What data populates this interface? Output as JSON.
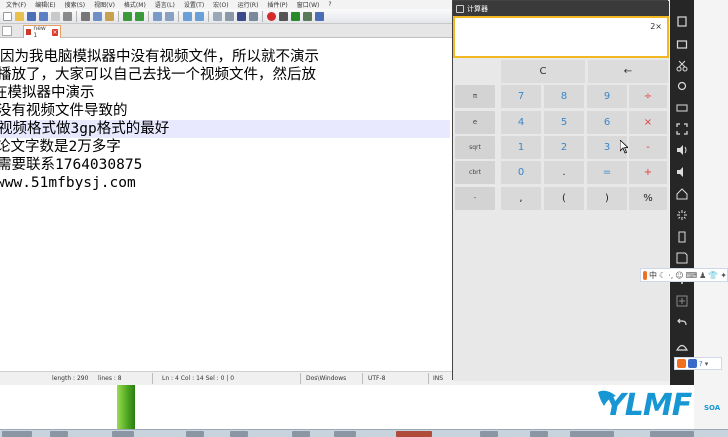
{
  "editor": {
    "menu": [
      "文件(F)",
      "编辑(E)",
      "搜索(S)",
      "视图(V)",
      "格式(M)",
      "语言(L)",
      "设置(T)",
      "宏(O)",
      "运行(R)",
      "插件(P)",
      "窗口(W)",
      "?"
    ],
    "tab": {
      "label": "new 1"
    },
    "lines": [
      "因为我电脑模拟器中没有视频文件，所以就不演示",
      "播放了，大家可以自己去找一个视频文件，然后放",
      "在模拟器中演示",
      "没有视频文件导致的",
      "视频格式做3gp格式的最好",
      "论文字数是2万多字",
      "需要联系1764030875",
      "www.51mfbysj.com"
    ],
    "status": {
      "length": "length : 290",
      "lines": "lines : 8",
      "position": "Ln : 4    Col : 14    Sel : 0 | 0",
      "eol": "Dos\\Windows",
      "encoding": "UTF-8",
      "mode": "INS"
    }
  },
  "emulator": {
    "app_title": "计算器",
    "display": {
      "formula": "2×"
    },
    "keys": {
      "clear": "C",
      "backspace": "←",
      "rows": [
        [
          "π",
          "7",
          "8",
          "9",
          "÷"
        ],
        [
          "e",
          "4",
          "5",
          "6",
          "×"
        ],
        [
          "sqrt",
          "1",
          "2",
          "3",
          "-"
        ],
        [
          "cbrt",
          "0",
          ".",
          "=",
          "+"
        ],
        [
          "-",
          ",",
          "(",
          ")",
          "%"
        ]
      ]
    }
  },
  "ime": {
    "label": "中"
  },
  "logo": {
    "text": "YLMF",
    "sub": "SOA"
  },
  "colors": {
    "accent_orange": "#f2b824",
    "digit_blue": "#3a86c8",
    "operator_red": "#e83c3c",
    "logo_blue": "#1796d4"
  }
}
